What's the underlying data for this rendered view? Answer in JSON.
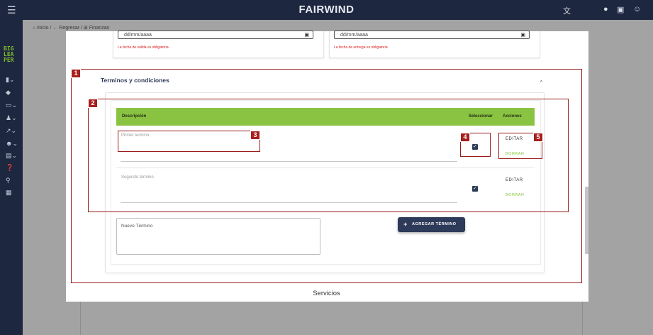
{
  "topbar": {
    "title": "FAIRWIND",
    "menu_icon": "hamburger-icon",
    "translate_icon": "translate-icon",
    "bell_icon": "bell-icon",
    "chat_icon": "chat-icon",
    "account_icon": "account-icon"
  },
  "sidebar": {
    "logo_lines": [
      "BIG",
      "LEA",
      "PER"
    ],
    "items": [
      "document-icon",
      "tag-icon",
      "card-icon",
      "person-icon",
      "chart-icon",
      "people-icon",
      "folder-icon",
      "help-icon",
      "search-icon",
      "book-icon"
    ]
  },
  "breadcrumb": {
    "text": "⌂ Inicio / ← Regresar / ⊞ Finanzas"
  },
  "dates": {
    "left": {
      "value": "dd/mm/aaaa",
      "error": "La fecha de salida es obligatoria"
    },
    "right": {
      "value": "dd/mm/aaaa",
      "error": "La fecha de entrega es obligatoria"
    }
  },
  "terms_section": {
    "title": "Terminos y condiciones",
    "columns": {
      "description": "Descripción",
      "select": "Seleccionar",
      "actions": "Acciones"
    },
    "rows": [
      {
        "text": "Primer termino",
        "checked": true,
        "edit": "EDITAR",
        "delete": "BORRAR"
      },
      {
        "text": "Segundo termino",
        "checked": true,
        "edit": "EDITAR",
        "delete": "BORRAR"
      }
    ],
    "new_term_label": "Nuevo Término",
    "add_button": "AGREGAR TÉRMINO"
  },
  "next_section": {
    "title": "Servicios"
  },
  "annotations": [
    "1",
    "2",
    "3",
    "4",
    "5"
  ],
  "colors": {
    "navy": "#1e2740",
    "accent": "#2e3a59",
    "green": "#8ac341",
    "error": "#d8201d",
    "annotation": "#a81f1f"
  }
}
